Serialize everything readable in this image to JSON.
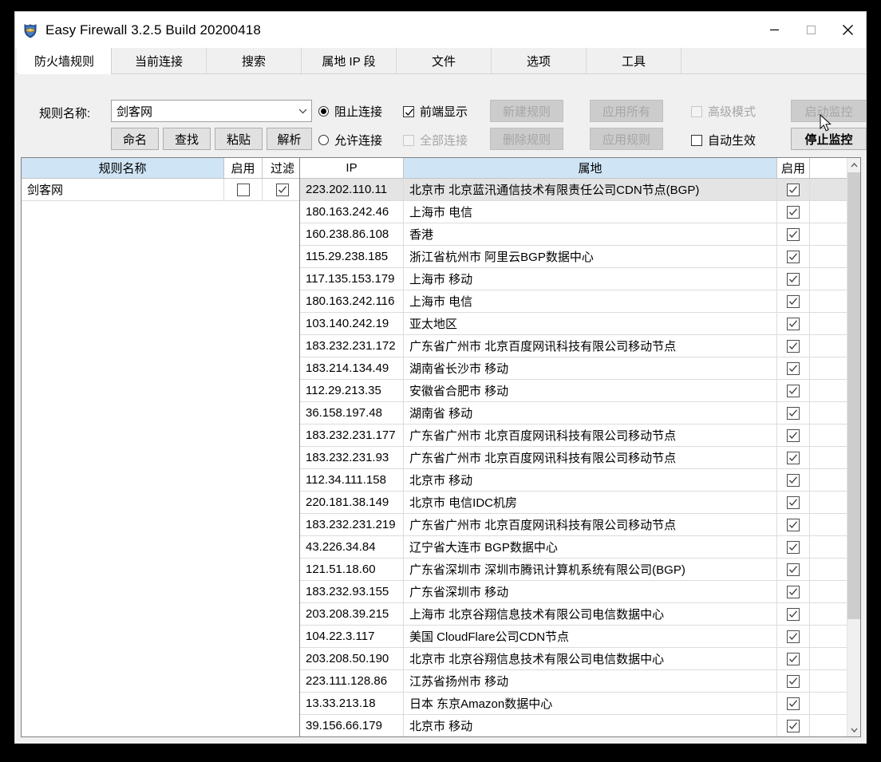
{
  "window": {
    "title": "Easy Firewall 3.2.5 Build 20200418",
    "icon": "shield-icon",
    "controls": {
      "minimize": "minimize-icon",
      "maximize": "maximize-icon",
      "close": "close-icon"
    }
  },
  "tabs": [
    {
      "label": "防火墙规则",
      "active": true
    },
    {
      "label": "当前连接",
      "active": false
    },
    {
      "label": "搜索",
      "active": false
    },
    {
      "label": "属地 IP 段",
      "active": false
    },
    {
      "label": "文件",
      "active": false
    },
    {
      "label": "选项",
      "active": false
    },
    {
      "label": "工具",
      "active": false
    }
  ],
  "toolbar": {
    "rule_name_label": "规则名称:",
    "rule_name_value": "剑客网",
    "buttons": {
      "rename": "命名",
      "find": "查找",
      "paste": "粘贴",
      "parse": "解析",
      "new_rule": "新建规则",
      "delete_rule": "删除规则",
      "apply_all": "应用所有",
      "apply_rule": "应用规则",
      "start_monitor": "启动监控",
      "stop_monitor": "停止监控"
    },
    "radios": {
      "block": "阻止连接",
      "allow": "允许连接",
      "selected": "block"
    },
    "checkboxes": {
      "front_display": "前端显示",
      "all_connections": "全部连接",
      "advanced_mode": "高级模式",
      "auto_effect": "自动生效"
    }
  },
  "rule_list": {
    "headers": {
      "name": "规则名称",
      "enable": "启用",
      "filter": "过滤"
    },
    "rows": [
      {
        "name": "剑客网",
        "enable": false,
        "filter": true
      }
    ]
  },
  "ip_table": {
    "headers": {
      "ip": "IP",
      "location": "属地",
      "enable": "启用"
    },
    "rows": [
      {
        "ip": "223.202.110.11",
        "location": "北京市 北京蓝汛通信技术有限责任公司CDN节点(BGP)",
        "enable": true,
        "selected": true
      },
      {
        "ip": "180.163.242.46",
        "location": "上海市 电信",
        "enable": true
      },
      {
        "ip": "160.238.86.108",
        "location": "香港",
        "enable": true
      },
      {
        "ip": "115.29.238.185",
        "location": "浙江省杭州市 阿里云BGP数据中心",
        "enable": true
      },
      {
        "ip": "117.135.153.179",
        "location": "上海市 移动",
        "enable": true
      },
      {
        "ip": "180.163.242.116",
        "location": "上海市 电信",
        "enable": true
      },
      {
        "ip": "103.140.242.19",
        "location": "亚太地区",
        "enable": true
      },
      {
        "ip": "183.232.231.172",
        "location": "广东省广州市 北京百度网讯科技有限公司移动节点",
        "enable": true
      },
      {
        "ip": "183.214.134.49",
        "location": "湖南省长沙市 移动",
        "enable": true
      },
      {
        "ip": "112.29.213.35",
        "location": "安徽省合肥市 移动",
        "enable": true
      },
      {
        "ip": "36.158.197.48",
        "location": "湖南省 移动",
        "enable": true
      },
      {
        "ip": "183.232.231.177",
        "location": "广东省广州市 北京百度网讯科技有限公司移动节点",
        "enable": true
      },
      {
        "ip": "183.232.231.93",
        "location": "广东省广州市 北京百度网讯科技有限公司移动节点",
        "enable": true
      },
      {
        "ip": "112.34.111.158",
        "location": "北京市 移动",
        "enable": true
      },
      {
        "ip": "220.181.38.149",
        "location": "北京市 电信IDC机房",
        "enable": true
      },
      {
        "ip": "183.232.231.219",
        "location": "广东省广州市 北京百度网讯科技有限公司移动节点",
        "enable": true
      },
      {
        "ip": "43.226.34.84",
        "location": "辽宁省大连市 BGP数据中心",
        "enable": true
      },
      {
        "ip": "121.51.18.60",
        "location": "广东省深圳市 深圳市腾讯计算机系统有限公司(BGP)",
        "enable": true
      },
      {
        "ip": "183.232.93.155",
        "location": "广东省深圳市 移动",
        "enable": true
      },
      {
        "ip": "203.208.39.215",
        "location": "上海市 北京谷翔信息技术有限公司电信数据中心",
        "enable": true
      },
      {
        "ip": "104.22.3.117",
        "location": "美国 CloudFlare公司CDN节点",
        "enable": true
      },
      {
        "ip": "203.208.50.190",
        "location": "北京市 北京谷翔信息技术有限公司电信数据中心",
        "enable": true
      },
      {
        "ip": "223.111.128.86",
        "location": "江苏省扬州市 移动",
        "enable": true
      },
      {
        "ip": "13.33.213.18",
        "location": "日本 东京Amazon数据中心",
        "enable": true
      },
      {
        "ip": "39.156.66.179",
        "location": "北京市 移动",
        "enable": true
      }
    ]
  },
  "scrollbar": {
    "up": "scroll-up-icon",
    "down": "scroll-down-icon"
  },
  "colors": {
    "header_blue": "#cfe4f5",
    "window_bg": "#f0f0f0",
    "selected_row": "#e4e4e4",
    "disabled_text": "#a6a6a6"
  }
}
